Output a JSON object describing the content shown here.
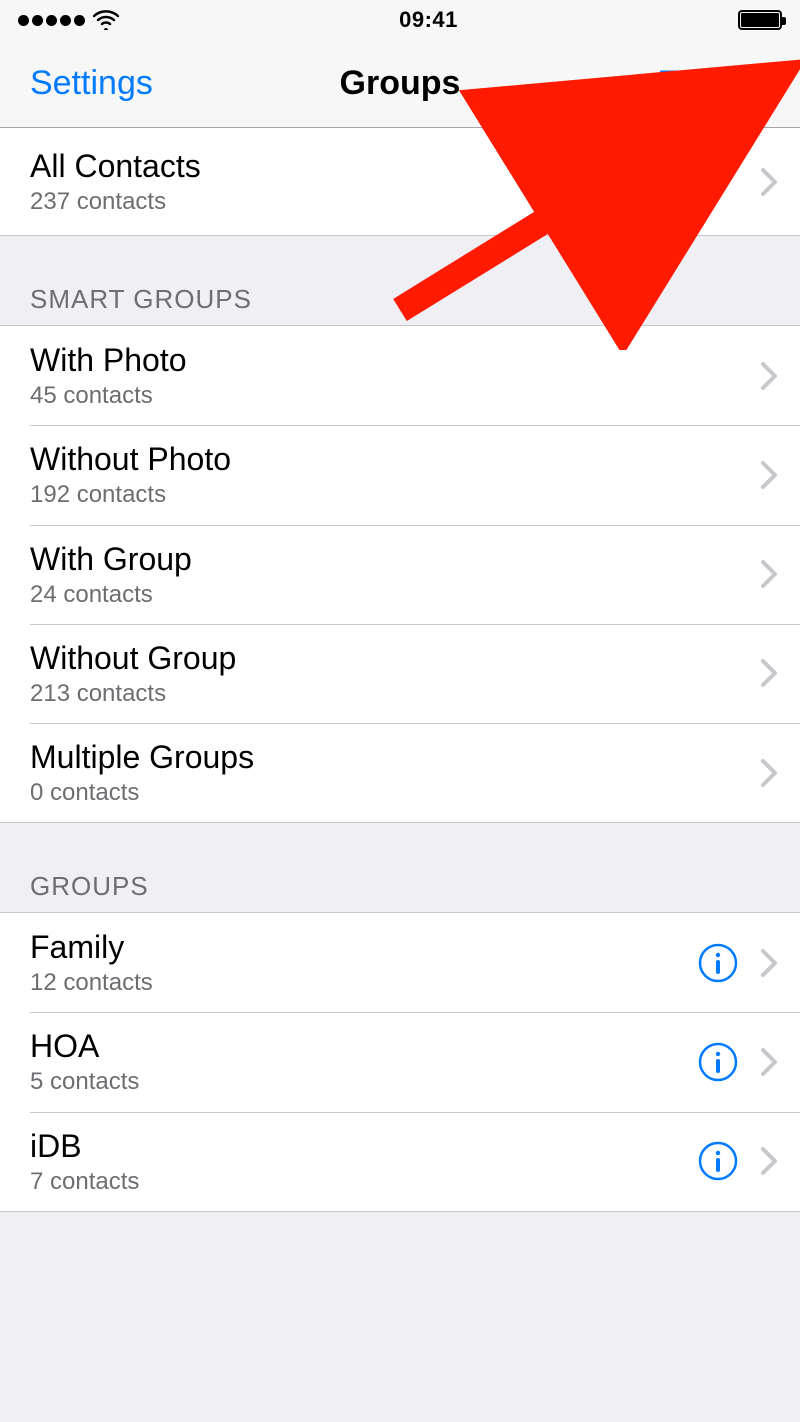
{
  "status": {
    "time": "09:41"
  },
  "nav": {
    "back": "Settings",
    "title": "Groups",
    "edit": "Edit"
  },
  "all_contacts": {
    "title": "All Contacts",
    "sub": "237 contacts"
  },
  "sections": {
    "smart_header": "SMART GROUPS",
    "groups_header": "GROUPS"
  },
  "smart_groups": [
    {
      "title": "With Photo",
      "sub": "45 contacts"
    },
    {
      "title": "Without Photo",
      "sub": "192 contacts"
    },
    {
      "title": "With Group",
      "sub": "24 contacts"
    },
    {
      "title": "Without Group",
      "sub": "213 contacts"
    },
    {
      "title": "Multiple Groups",
      "sub": "0 contacts"
    }
  ],
  "groups": [
    {
      "title": "Family",
      "sub": "12 contacts"
    },
    {
      "title": "HOA",
      "sub": "5 contacts"
    },
    {
      "title": "iDB",
      "sub": "7 contacts"
    }
  ]
}
